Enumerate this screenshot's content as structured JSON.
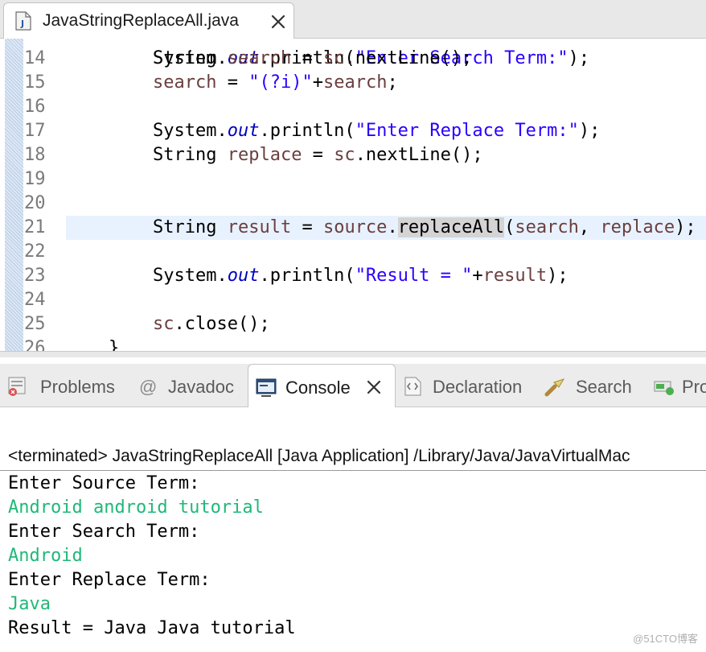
{
  "editor_tab": {
    "title": "JavaStringReplaceAll.java",
    "icon": "java-file-icon",
    "close_icon": "close-icon"
  },
  "editor": {
    "lines": [
      {
        "num": "14",
        "tokens": [
          {
            "t": "String ",
            "c": ""
          },
          {
            "t": "search",
            "c": "kw-var"
          },
          {
            "t": " = ",
            "c": ""
          },
          {
            "t": "sc",
            "c": "kw-var"
          },
          {
            "t": ".nextLine();",
            "c": ""
          }
        ]
      },
      {
        "num": "15",
        "tokens": [
          {
            "t": "search",
            "c": "kw-var"
          },
          {
            "t": " = ",
            "c": ""
          },
          {
            "t": "\"(?i)\"",
            "c": "kw-str"
          },
          {
            "t": "+",
            "c": ""
          },
          {
            "t": "search",
            "c": "kw-var"
          },
          {
            "t": ";",
            "c": ""
          }
        ]
      },
      {
        "num": "16",
        "tokens": []
      },
      {
        "num": "17",
        "tokens": [
          {
            "t": "System.",
            "c": ""
          },
          {
            "t": "out",
            "c": "kw-field"
          },
          {
            "t": ".println(",
            "c": ""
          },
          {
            "t": "\"Enter Replace Term:\"",
            "c": "kw-str"
          },
          {
            "t": ");",
            "c": ""
          }
        ]
      },
      {
        "num": "18",
        "tokens": [
          {
            "t": "String ",
            "c": ""
          },
          {
            "t": "replace",
            "c": "kw-var"
          },
          {
            "t": " = ",
            "c": ""
          },
          {
            "t": "sc",
            "c": "kw-var"
          },
          {
            "t": ".nextLine();",
            "c": ""
          }
        ]
      },
      {
        "num": "19",
        "tokens": []
      },
      {
        "num": "20",
        "tokens": []
      },
      {
        "num": "21",
        "current": true,
        "tokens": [
          {
            "t": "String ",
            "c": ""
          },
          {
            "t": "result",
            "c": "kw-var"
          },
          {
            "t": " = ",
            "c": ""
          },
          {
            "t": "source",
            "c": "kw-var"
          },
          {
            "t": ".",
            "c": ""
          },
          {
            "t": "replaceAll",
            "c": "occ"
          },
          {
            "t": "(",
            "c": ""
          },
          {
            "t": "search",
            "c": "kw-var"
          },
          {
            "t": ", ",
            "c": ""
          },
          {
            "t": "replace",
            "c": "kw-var"
          },
          {
            "t": ");",
            "c": ""
          }
        ]
      },
      {
        "num": "22",
        "tokens": []
      },
      {
        "num": "23",
        "tokens": [
          {
            "t": "System.",
            "c": ""
          },
          {
            "t": "out",
            "c": "kw-field"
          },
          {
            "t": ".println(",
            "c": ""
          },
          {
            "t": "\"Result = \"",
            "c": "kw-str"
          },
          {
            "t": "+",
            "c": ""
          },
          {
            "t": "result",
            "c": "kw-var"
          },
          {
            "t": ");",
            "c": ""
          }
        ]
      },
      {
        "num": "24",
        "tokens": []
      },
      {
        "num": "25",
        "tokens": [
          {
            "t": "sc",
            "c": "kw-var"
          },
          {
            "t": ".close();",
            "c": ""
          }
        ]
      },
      {
        "num": "26",
        "tokens": [
          {
            "t": "}",
            "c": ""
          }
        ],
        "indent": "outer"
      }
    ]
  },
  "view_tabs": [
    {
      "label": "Problems",
      "icon": "problems-icon",
      "active": false
    },
    {
      "label": "Javadoc",
      "icon": "at-sign-icon",
      "active": false
    },
    {
      "label": "Console",
      "icon": "console-icon",
      "active": true
    },
    {
      "label": "Declaration",
      "icon": "declaration-icon",
      "active": false
    },
    {
      "label": "Search",
      "icon": "search-flashlight-icon",
      "active": false
    },
    {
      "label": "Pro",
      "icon": "progress-icon",
      "active": false
    }
  ],
  "console": {
    "header": "<terminated> JavaStringReplaceAll [Java Application] /Library/Java/JavaVirtualMac",
    "lines": [
      {
        "text": "Enter Source Term:",
        "kind": "out"
      },
      {
        "text": "Android android tutorial",
        "kind": "in"
      },
      {
        "text": "Enter Search Term:",
        "kind": "out"
      },
      {
        "text": "Android",
        "kind": "in"
      },
      {
        "text": "Enter Replace Term:",
        "kind": "out"
      },
      {
        "text": "Java",
        "kind": "in"
      },
      {
        "text": "Result = Java Java tutorial",
        "kind": "out"
      }
    ]
  },
  "watermark": "@51CTO博客",
  "colors": {
    "keyword_var": "#6a3e3e",
    "string": "#2a00ff",
    "static_field": "#0000c0",
    "console_input": "#20b878",
    "current_line": "#e8f2fe"
  }
}
